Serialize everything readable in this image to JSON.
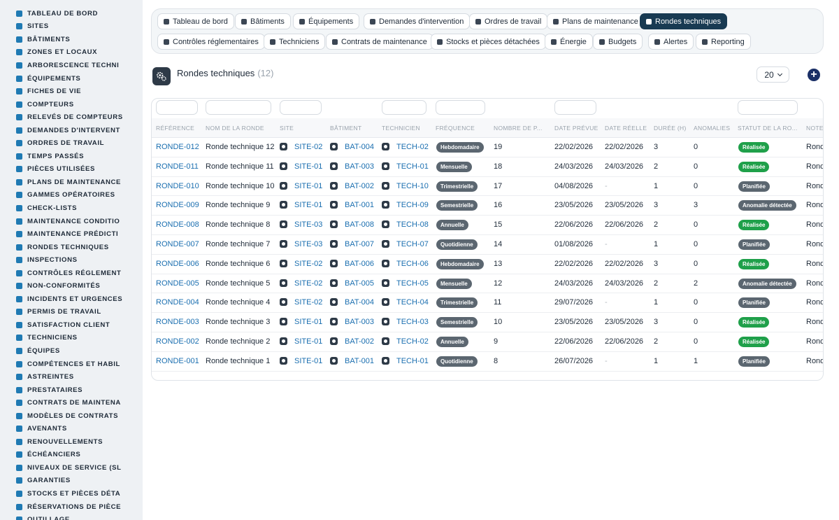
{
  "sidebar": {
    "items": [
      {
        "label": "TABLEAU DE BORD",
        "icon": "dashboard-icon"
      },
      {
        "label": "SITES",
        "icon": "map-pin-icon"
      },
      {
        "label": "BÂTIMENTS",
        "icon": "building-icon"
      },
      {
        "label": "ZONES ET LOCAUX",
        "icon": "zone-icon"
      },
      {
        "label": "ARBORESCENCE TECHNI",
        "icon": "tree-icon"
      },
      {
        "label": "ÉQUIPEMENTS",
        "icon": "cogs-icon"
      },
      {
        "label": "FICHES DE VIE",
        "icon": "history-icon"
      },
      {
        "label": "COMPTEURS",
        "icon": "gauge-icon"
      },
      {
        "label": "RELEVÉS DE COMPTEURS",
        "icon": "list-icon"
      },
      {
        "label": "DEMANDES D'INTERVENT",
        "icon": "question-icon"
      },
      {
        "label": "ORDRES DE TRAVAIL",
        "icon": "clipboard-icon"
      },
      {
        "label": "TEMPS PASSÉS",
        "icon": "clock-icon"
      },
      {
        "label": "PIÈCES UTILISÉES",
        "icon": "parts-icon"
      },
      {
        "label": "PLANS DE MAINTENANCE",
        "icon": "calendar-icon"
      },
      {
        "label": "GAMMES OPÉRATOIRES",
        "icon": "grid-icon"
      },
      {
        "label": "CHECK-LISTS",
        "icon": "checklist-icon"
      },
      {
        "label": "MAINTENANCE CONDITIO",
        "icon": "thermometer-icon"
      },
      {
        "label": "MAINTENANCE PRÉDICTI",
        "icon": "chart-icon"
      },
      {
        "label": "RONDES TECHNIQUES",
        "icon": "route-icon"
      },
      {
        "label": "INSPECTIONS",
        "icon": "search-icon"
      },
      {
        "label": "CONTRÔLES RÉGLEMENT",
        "icon": "clipboard-check-icon"
      },
      {
        "label": "NON-CONFORMITÉS",
        "icon": "alert-circle-icon"
      },
      {
        "label": "INCIDENTS ET URGENCES",
        "icon": "warning-icon"
      },
      {
        "label": "PERMIS DE TRAVAIL",
        "icon": "permit-icon"
      },
      {
        "label": "SATISFACTION CLIENT",
        "icon": "smile-icon"
      },
      {
        "label": "TECHNICIENS",
        "icon": "hard-hat-icon"
      },
      {
        "label": "ÉQUIPES",
        "icon": "users-icon"
      },
      {
        "label": "COMPÉTENCES ET HABIL",
        "icon": "certificate-icon"
      },
      {
        "label": "ASTREINTES",
        "icon": "phone-icon"
      },
      {
        "label": "PRESTATAIRES",
        "icon": "handshake-icon"
      },
      {
        "label": "CONTRATS DE MAINTENA",
        "icon": "contract-icon"
      },
      {
        "label": "MODÈLES DE CONTRATS",
        "icon": "file-icon"
      },
      {
        "label": "AVENANTS",
        "icon": "file-plus-icon"
      },
      {
        "label": "RENOUVELLEMENTS",
        "icon": "refresh-icon"
      },
      {
        "label": "ÉCHÉANCIERS",
        "icon": "calendar-icon"
      },
      {
        "label": "NIVEAUX DE SERVICE (SL",
        "icon": "sla-icon"
      },
      {
        "label": "GARANTIES",
        "icon": "shield-icon"
      },
      {
        "label": "STOCKS ET PIÈCES DÉTA",
        "icon": "boxes-icon"
      },
      {
        "label": "RÉSERVATIONS DE PIÈCE",
        "icon": "bookmark-icon"
      },
      {
        "label": "OUTILLAGE",
        "icon": "tools-icon"
      }
    ]
  },
  "tabs": [
    {
      "label": "Tableau de bord",
      "icon": "dashboard-icon",
      "active": false
    },
    {
      "label": "Bâtiments",
      "icon": "building-icon",
      "active": false
    },
    {
      "label": "Équipements",
      "icon": "cogs-icon",
      "active": false
    },
    {
      "label": "Demandes d'intervention",
      "icon": "question-icon",
      "active": false
    },
    {
      "label": "Ordres de travail",
      "icon": "clipboard-icon",
      "active": false
    },
    {
      "label": "Plans de maintenance",
      "icon": "calendar-icon",
      "active": false
    },
    {
      "label": "Rondes techniques",
      "icon": "route-icon",
      "active": true
    },
    {
      "label": "Contrôles réglementaires",
      "icon": "clipboard-check-icon",
      "active": false
    },
    {
      "label": "Techniciens",
      "icon": "hard-hat-icon",
      "active": false
    },
    {
      "label": "Contrats de maintenance",
      "icon": "contract-icon",
      "active": false
    },
    {
      "label": "Stocks et pièces détachées",
      "icon": "boxes-icon",
      "active": false
    },
    {
      "label": "Énergie",
      "icon": "bolt-icon",
      "active": false
    },
    {
      "label": "Budgets",
      "icon": "money-icon",
      "active": false
    },
    {
      "label": "Alertes",
      "icon": "bell-icon",
      "active": false
    },
    {
      "label": "Reporting",
      "icon": "pie-chart-icon",
      "active": false
    }
  ],
  "page": {
    "title": "Rondes techniques",
    "count": "(12)",
    "per_page": "20",
    "add_label": "+"
  },
  "table": {
    "columns": [
      "RÉFÉRENCE",
      "NOM DE LA RONDE",
      "SITE",
      "BÂTIMENT",
      "TECHNICIEN",
      "FRÉQUENCE",
      "NOMBRE DE P...",
      "DATE PRÉVUE",
      "DATE RÉELLE",
      "DURÉE (H)",
      "ANOMALIES",
      "STATUT DE LA RO...",
      "NOTE"
    ],
    "rows": [
      {
        "ref": "RONDE-012",
        "name": "Ronde technique 12",
        "site": "SITE-02",
        "bat": "BAT-004",
        "tech": "TECH-02",
        "freq": "Hebdomadaire",
        "points": "19",
        "planned": "22/02/2026",
        "actual": "22/02/2026",
        "duration": "3",
        "anomalies": "0",
        "status": "Réalisée",
        "note": "Ronde"
      },
      {
        "ref": "RONDE-011",
        "name": "Ronde technique 11",
        "site": "SITE-01",
        "bat": "BAT-003",
        "tech": "TECH-01",
        "freq": "Mensuelle",
        "points": "18",
        "planned": "24/03/2026",
        "actual": "24/03/2026",
        "duration": "2",
        "anomalies": "0",
        "status": "Réalisée",
        "note": "Ronde"
      },
      {
        "ref": "RONDE-010",
        "name": "Ronde technique 10",
        "site": "SITE-01",
        "bat": "BAT-002",
        "tech": "TECH-10",
        "freq": "Trimestrielle",
        "points": "17",
        "planned": "04/08/2026",
        "actual": "-",
        "duration": "1",
        "anomalies": "0",
        "status": "Planifiée",
        "note": "Ronde"
      },
      {
        "ref": "RONDE-009",
        "name": "Ronde technique 9",
        "site": "SITE-01",
        "bat": "BAT-001",
        "tech": "TECH-09",
        "freq": "Semestrielle",
        "points": "16",
        "planned": "23/05/2026",
        "actual": "23/05/2026",
        "duration": "3",
        "anomalies": "3",
        "status": "Anomalie détectée",
        "note": "Ronde"
      },
      {
        "ref": "RONDE-008",
        "name": "Ronde technique 8",
        "site": "SITE-03",
        "bat": "BAT-008",
        "tech": "TECH-08",
        "freq": "Annuelle",
        "points": "15",
        "planned": "22/06/2026",
        "actual": "22/06/2026",
        "duration": "2",
        "anomalies": "0",
        "status": "Réalisée",
        "note": "Ronde"
      },
      {
        "ref": "RONDE-007",
        "name": "Ronde technique 7",
        "site": "SITE-03",
        "bat": "BAT-007",
        "tech": "TECH-07",
        "freq": "Quotidienne",
        "points": "14",
        "planned": "01/08/2026",
        "actual": "-",
        "duration": "1",
        "anomalies": "0",
        "status": "Planifiée",
        "note": "Ronde"
      },
      {
        "ref": "RONDE-006",
        "name": "Ronde technique 6",
        "site": "SITE-02",
        "bat": "BAT-006",
        "tech": "TECH-06",
        "freq": "Hebdomadaire",
        "points": "13",
        "planned": "22/02/2026",
        "actual": "22/02/2026",
        "duration": "3",
        "anomalies": "0",
        "status": "Réalisée",
        "note": "Ronde"
      },
      {
        "ref": "RONDE-005",
        "name": "Ronde technique 5",
        "site": "SITE-02",
        "bat": "BAT-005",
        "tech": "TECH-05",
        "freq": "Mensuelle",
        "points": "12",
        "planned": "24/03/2026",
        "actual": "24/03/2026",
        "duration": "2",
        "anomalies": "2",
        "status": "Anomalie détectée",
        "note": "Ronde"
      },
      {
        "ref": "RONDE-004",
        "name": "Ronde technique 4",
        "site": "SITE-02",
        "bat": "BAT-004",
        "tech": "TECH-04",
        "freq": "Trimestrielle",
        "points": "11",
        "planned": "29/07/2026",
        "actual": "-",
        "duration": "1",
        "anomalies": "0",
        "status": "Planifiée",
        "note": "Ronde"
      },
      {
        "ref": "RONDE-003",
        "name": "Ronde technique 3",
        "site": "SITE-01",
        "bat": "BAT-003",
        "tech": "TECH-03",
        "freq": "Semestrielle",
        "points": "10",
        "planned": "23/05/2026",
        "actual": "23/05/2026",
        "duration": "3",
        "anomalies": "0",
        "status": "Réalisée",
        "note": "Ronde"
      },
      {
        "ref": "RONDE-002",
        "name": "Ronde technique 2",
        "site": "SITE-01",
        "bat": "BAT-002",
        "tech": "TECH-02",
        "freq": "Annuelle",
        "points": "9",
        "planned": "22/06/2026",
        "actual": "22/06/2026",
        "duration": "2",
        "anomalies": "0",
        "status": "Réalisée",
        "note": "Ronde"
      },
      {
        "ref": "RONDE-001",
        "name": "Ronde technique 1",
        "site": "SITE-01",
        "bat": "BAT-001",
        "tech": "TECH-01",
        "freq": "Quotidienne",
        "points": "8",
        "planned": "26/07/2026",
        "actual": "-",
        "duration": "1",
        "anomalies": "1",
        "status": "Planifiée",
        "note": "Ronde"
      }
    ]
  },
  "colors": {
    "accent": "#183a52",
    "link": "#1b6fb0",
    "status_done": "#1fa04a",
    "status_planned": "#5b6670",
    "status_anomaly": "#5b6670",
    "frequency_pill": "#5b6670"
  }
}
